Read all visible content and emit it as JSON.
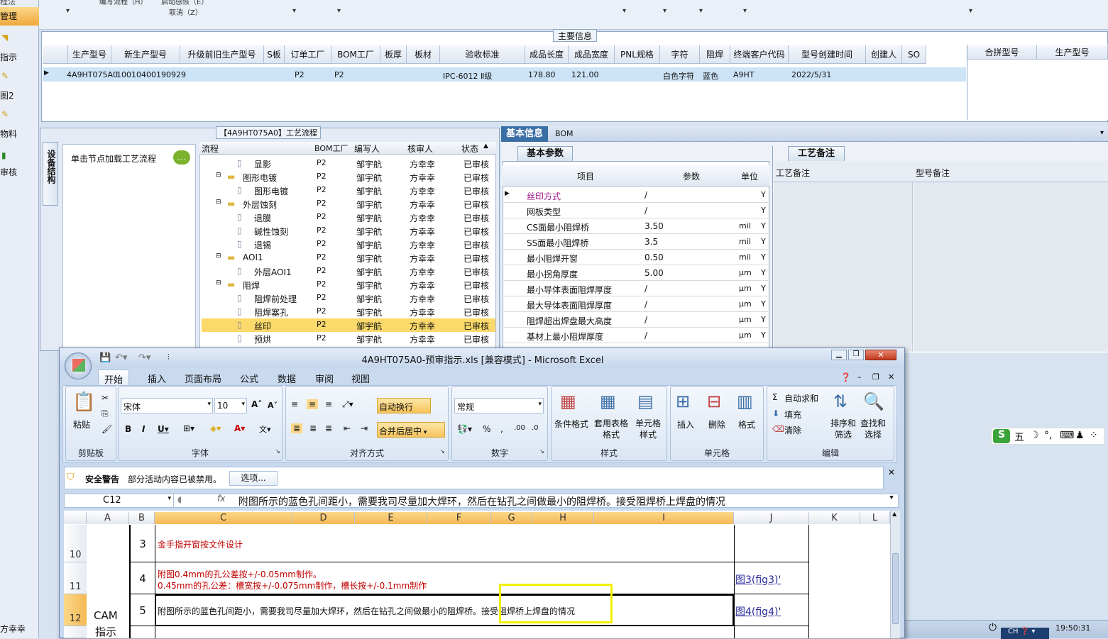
{
  "left_nav": {
    "items": [
      "管理",
      "指示",
      "图2",
      "物料",
      "审核"
    ],
    "partial_top": "程法",
    "bottom_user": "方幸幸"
  },
  "top_toolbar": {
    "labels": [
      "编写流程（H）",
      "启动感恢（E）",
      "取消（Z）"
    ]
  },
  "main_info": {
    "title": "主要信息",
    "columns": [
      "生产型号",
      "新生产型号",
      "升级前旧生产型号",
      "S板",
      "订单工厂",
      "BOM工厂",
      "板厚",
      "板材",
      "验收标准",
      "成品长度",
      "成品宽度",
      "PNL规格",
      "字符",
      "阻焊",
      "终端客户代码",
      "型号创建时间",
      "创建人",
      "SO"
    ],
    "row": [
      "4A9HT075A0",
      "10010400190929",
      "",
      "",
      "P2",
      "P2",
      "",
      "",
      "IPC-6012 Ⅱ级",
      "178.80",
      "121.00",
      "",
      "白色字符",
      "蓝色",
      "A9HT",
      "2022/5/31",
      "",
      ""
    ],
    "side_columns": [
      "合拼型号",
      "生产型号"
    ]
  },
  "process": {
    "title": "【4A9HT075A0】工艺流程",
    "side_tab": "设备结构",
    "hint": "单击节点加载工艺流程",
    "columns": [
      "流程",
      "BOM工厂",
      "编写人",
      "核审人",
      "状态"
    ],
    "rows": [
      {
        "name": "显影",
        "level": 2,
        "factory": "P2",
        "writer": "邹宇航",
        "reviewer": "方幸幸",
        "status": "已审核"
      },
      {
        "name": "图形电镀",
        "level": 1,
        "factory": "P2",
        "writer": "邹宇航",
        "reviewer": "方幸幸",
        "status": "已审核"
      },
      {
        "name": "图形电镀",
        "level": 2,
        "factory": "P2",
        "writer": "邹宇航",
        "reviewer": "方幸幸",
        "status": "已审核"
      },
      {
        "name": "外层蚀刻",
        "level": 1,
        "factory": "P2",
        "writer": "邹宇航",
        "reviewer": "方幸幸",
        "status": "已审核"
      },
      {
        "name": "退膜",
        "level": 2,
        "factory": "P2",
        "writer": "邹宇航",
        "reviewer": "方幸幸",
        "status": "已审核"
      },
      {
        "name": "碱性蚀刻",
        "level": 2,
        "factory": "P2",
        "writer": "邹宇航",
        "reviewer": "方幸幸",
        "status": "已审核"
      },
      {
        "name": "退锡",
        "level": 2,
        "factory": "P2",
        "writer": "邹宇航",
        "reviewer": "方幸幸",
        "status": "已审核"
      },
      {
        "name": "AOI1",
        "level": 1,
        "factory": "P2",
        "writer": "邹宇航",
        "reviewer": "方幸幸",
        "status": "已审核"
      },
      {
        "name": "外层AOI1",
        "level": 2,
        "factory": "P2",
        "writer": "邹宇航",
        "reviewer": "方幸幸",
        "status": "已审核"
      },
      {
        "name": "阻焊",
        "level": 1,
        "factory": "P2",
        "writer": "邹宇航",
        "reviewer": "方幸幸",
        "status": "已审核"
      },
      {
        "name": "阻焊前处理",
        "level": 2,
        "factory": "P2",
        "writer": "邹宇航",
        "reviewer": "方幸幸",
        "status": "已审核"
      },
      {
        "name": "阻焊塞孔",
        "level": 2,
        "factory": "P2",
        "writer": "邹宇航",
        "reviewer": "方幸幸",
        "status": "已审核"
      },
      {
        "name": "丝印",
        "level": 2,
        "factory": "P2",
        "writer": "邹宇航",
        "reviewer": "方幸幸",
        "status": "已审核",
        "selected": true
      },
      {
        "name": "预烘",
        "level": 2,
        "factory": "P2",
        "writer": "邹宇航",
        "reviewer": "方幸幸",
        "status": "已审核"
      }
    ]
  },
  "basic_info": {
    "tabs": [
      "基本信息",
      "BOM"
    ],
    "subtab": "基本参数",
    "remarks_tab": "工艺备注",
    "remark_cols": [
      "工艺备注",
      "型号备注"
    ],
    "columns": [
      "项目",
      "参数",
      "单位"
    ],
    "rows": [
      {
        "item": "丝印方式",
        "param": "/",
        "unit": "",
        "flag": "Y"
      },
      {
        "item": "网板类型",
        "param": "/",
        "unit": "",
        "flag": "Y"
      },
      {
        "item": "CS面最小阻焊桥",
        "param": "3.50",
        "unit": "mil",
        "flag": "Y"
      },
      {
        "item": "SS面最小阻焊桥",
        "param": "3.5",
        "unit": "mil",
        "flag": "Y"
      },
      {
        "item": "最小阻焊开窗",
        "param": "0.50",
        "unit": "mil",
        "flag": "Y"
      },
      {
        "item": "最小拐角厚度",
        "param": "5.00",
        "unit": "μm",
        "flag": "Y"
      },
      {
        "item": "最小导体表面阻焊厚度",
        "param": "/",
        "unit": "μm",
        "flag": "Y"
      },
      {
        "item": "最大导体表面阻焊厚度",
        "param": "/",
        "unit": "μm",
        "flag": "Y"
      },
      {
        "item": "阻焊超出焊盘最大高度",
        "param": "/",
        "unit": "μm",
        "flag": "Y"
      },
      {
        "item": "基材上最小阻焊厚度",
        "param": "/",
        "unit": "μm",
        "flag": "Y"
      }
    ]
  },
  "excel": {
    "title": "4A9HT075A0-预审指示.xls  [兼容模式] - Microsoft Excel",
    "tabs": [
      "开始",
      "插入",
      "页面布局",
      "公式",
      "数据",
      "审阅",
      "视图"
    ],
    "ribbon": {
      "paste": "粘贴",
      "clipboard": "剪贴板",
      "font_name": "宋体",
      "font_size": "10",
      "font": "字体",
      "wrap": "自动换行",
      "merge": "合并后居中",
      "align": "对齐方式",
      "number_format": "常规",
      "number": "数字",
      "cond_format": "条件格式",
      "table_format": "套用表格格式",
      "cell_style": "单元格样式",
      "styles": "样式",
      "insert": "插入",
      "delete": "删除",
      "format": "格式",
      "cells": "单元格",
      "autosum": "自动求和",
      "fill": "填充",
      "clear": "清除",
      "sort": "排序和筛选",
      "find": "查找和选择",
      "editing": "编辑"
    },
    "security": {
      "label": "安全警告",
      "msg": "部分活动内容已被禁用。",
      "button": "选项..."
    },
    "namebox": "C12",
    "fx": "fx",
    "formula": "附图所示的蓝色孔间距小，需要我司尽量加大焊环，然后在钻孔之间做最小的阻焊桥。接受阻焊桥上焊盘的情况",
    "col_headers": [
      "A",
      "B",
      "C",
      "D",
      "E",
      "F",
      "G",
      "H",
      "I",
      "J",
      "K",
      "L"
    ],
    "rows": [
      {
        "num": "10",
        "b": "3",
        "c1": "金手指开窗按文件设计",
        "c2": "",
        "j": ""
      },
      {
        "num": "11",
        "b": "4",
        "c1": "附图0.4mm的孔公差按+/-0.05mm制作。",
        "c2": "0.45mm的孔公差：槽宽按+/-0.075mm制作，槽长按+/-0.1mm制作",
        "j": "图3(fig3)'"
      },
      {
        "num": "12",
        "b": "5",
        "c1": "附图所示的蓝色孔间距小，需要我司尽量加大焊环，然后在钻孔之间做最小的阻焊桥。接受阻焊桥上焊盘的情况",
        "c2": "",
        "j": "图4(fig4)'"
      }
    ],
    "a_label1": "CAM",
    "a_label2": "指示"
  },
  "ime": {
    "label": "五"
  },
  "taskbar": {
    "lang": "CH",
    "time": "19:50:31"
  },
  "colors": {
    "accent": "#3a6ea5",
    "selected_row": "#fbd96b",
    "grid_sel": "#cde3f7"
  }
}
